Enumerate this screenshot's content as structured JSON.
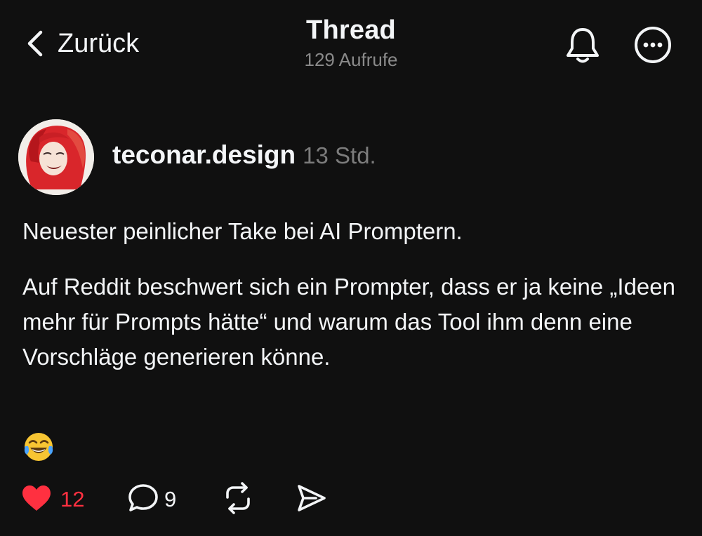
{
  "nav": {
    "back_label": "Zurück",
    "title": "Thread",
    "views": "129 Aufrufe"
  },
  "post": {
    "author": "teconar.design",
    "time": "13 Std.",
    "paragraph1": "Neuester peinlicher Take bei AI Promptern.",
    "paragraph2": "Auf Reddit beschwert sich ein Prompter, dass er ja keine „Ideen mehr für Prompts hätte“ und warum das Tool ihm denn eine Vorschläge generieren könne.",
    "emoji": "face-with-tears-of-joy"
  },
  "actions": {
    "likes": "12",
    "replies": "9",
    "like_color": "#ff3040"
  },
  "icons": [
    "chevron-left-icon",
    "bell-icon",
    "more-icon",
    "heart-icon",
    "comment-icon",
    "repost-icon",
    "share-icon"
  ],
  "colors": {
    "background": "#101010",
    "text": "#f3f5f7",
    "muted": "#8a8a8a",
    "like": "#ff3040"
  }
}
